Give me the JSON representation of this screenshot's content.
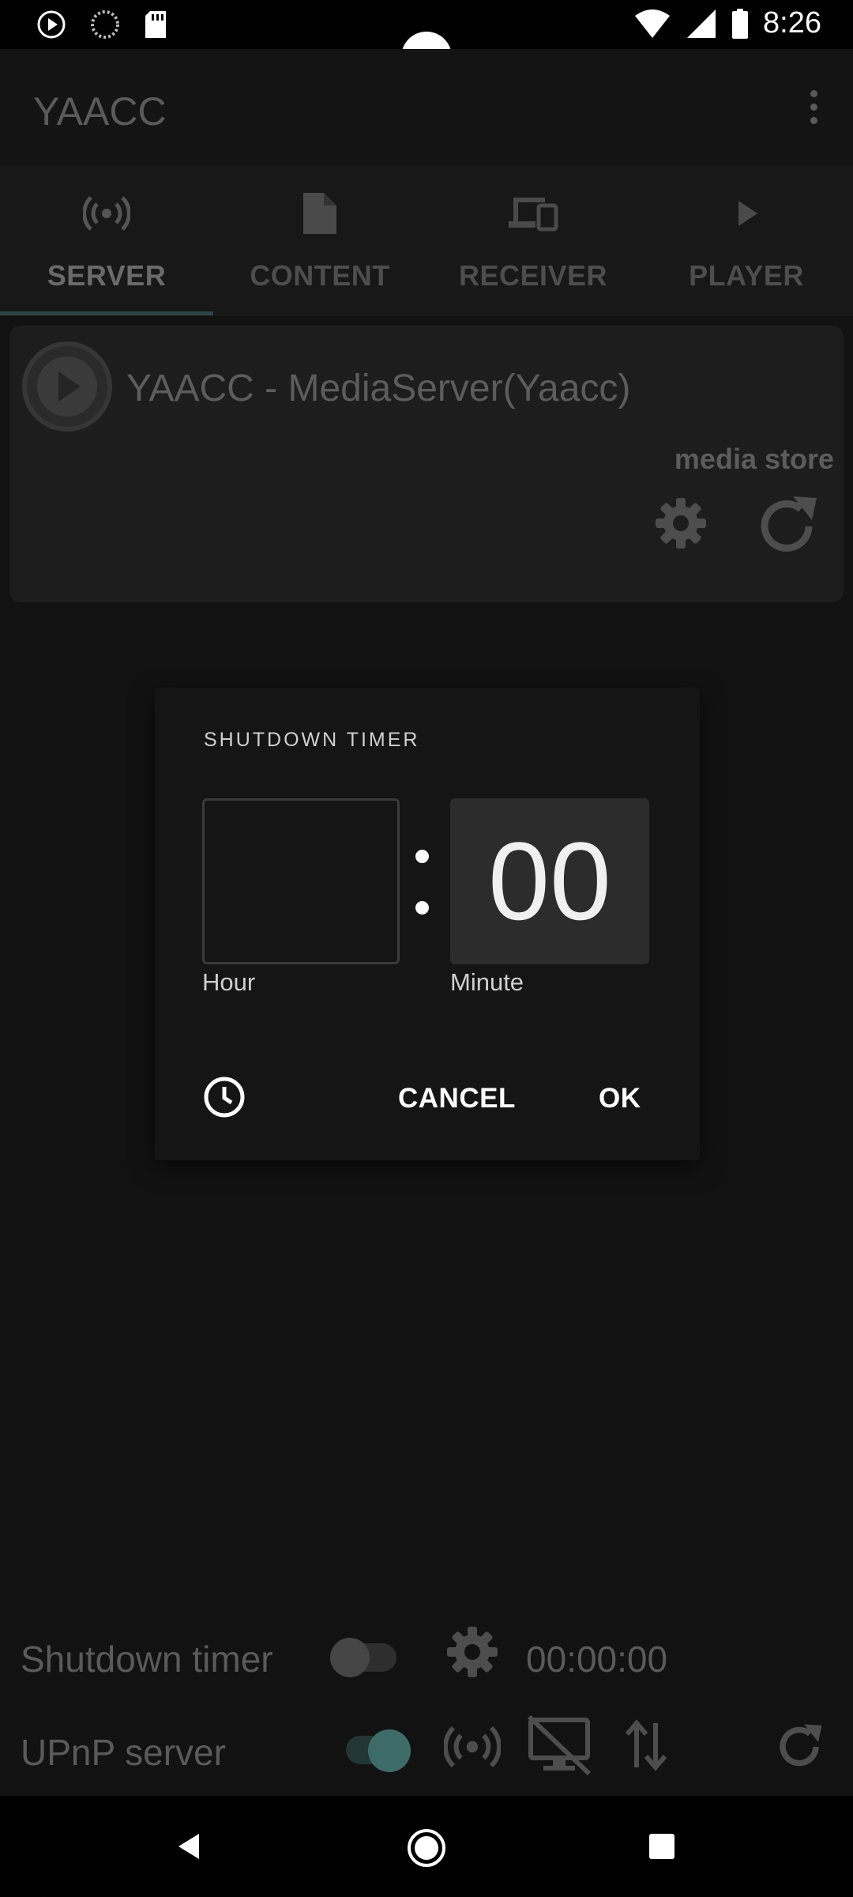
{
  "status_bar": {
    "time": "8:26"
  },
  "app_bar": {
    "title": "YAACC"
  },
  "tabs": [
    {
      "label": "SERVER",
      "icon": "broadcast-icon",
      "active": true
    },
    {
      "label": "CONTENT",
      "icon": "file-icon",
      "active": false
    },
    {
      "label": "RECEIVER",
      "icon": "devices-icon",
      "active": false
    },
    {
      "label": "PLAYER",
      "icon": "play-icon",
      "active": false
    }
  ],
  "server_card": {
    "title": "YAACC - MediaServer(Yaacc)",
    "subtitle": "media store"
  },
  "dialog": {
    "title": "SHUTDOWN TIMER",
    "hour_value": "",
    "minute_value": "00",
    "hour_label": "Hour",
    "minute_label": "Minute",
    "cancel_label": "CANCEL",
    "ok_label": "OK"
  },
  "bottom": {
    "shutdown_label": "Shutdown timer",
    "shutdown_enabled": false,
    "timer_value": "00:00:00",
    "upnp_label": "UPnP server",
    "upnp_enabled": true
  },
  "colors": {
    "background": "#121212",
    "accent": "#3d6b68",
    "dialog_bg": "#151515"
  }
}
